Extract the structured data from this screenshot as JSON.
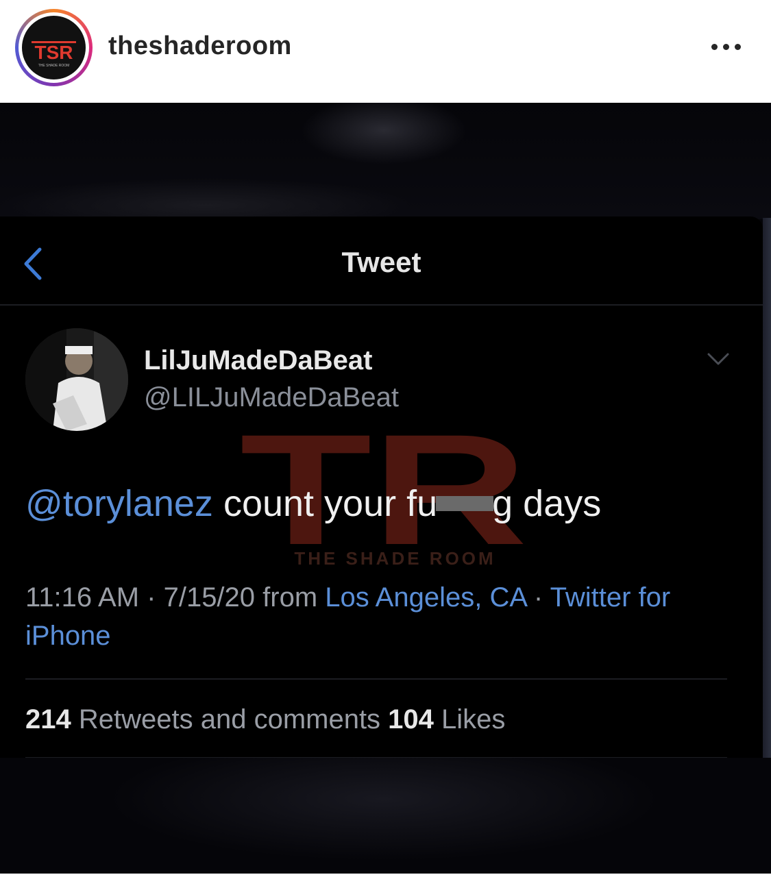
{
  "post": {
    "username": "theshaderoom",
    "avatar_logo": "TSR",
    "avatar_caption": "THE SHADE ROOM"
  },
  "tweet_screen": {
    "nav_title": "Tweet",
    "display_name": "LilJuMadeDaBeat",
    "handle": "@LILJuMadeDaBeat",
    "text_mention": "@torylanez",
    "text_before_censor": " count your fu",
    "text_after_censor": "g days",
    "time_date": "11:16 AM · 7/15/20 from ",
    "location": "Los Angeles, CA",
    "separator": " · ",
    "source": "Twitter for iPhone",
    "retweets_count": "214",
    "retweets_label": " Retweets and comments  ",
    "likes_count": "104",
    "likes_label": " Likes"
  },
  "watermark": {
    "letters": "TR",
    "text": "THE SHADE ROOM"
  },
  "colors": {
    "link_blue": "#5b8fd8",
    "watermark_red": "#5a1a12",
    "background": "#000000"
  },
  "icons": [
    "more-options-icon",
    "back-chevron-icon",
    "chevron-down-icon"
  ]
}
